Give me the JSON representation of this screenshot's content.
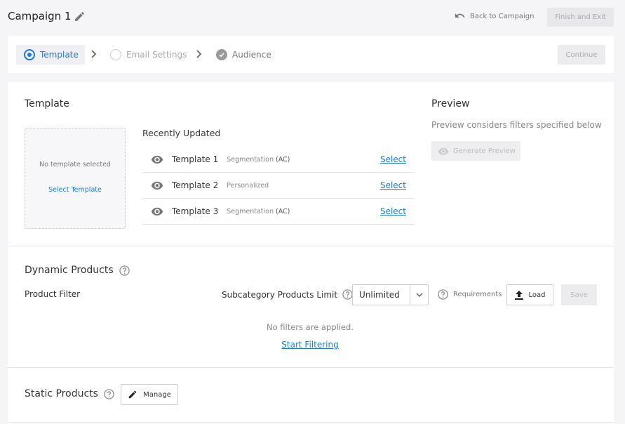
{
  "header": {
    "title": "Campaign 1",
    "back_label": "Back to Campaign",
    "finish_label": "Finish and Exit"
  },
  "steps": [
    {
      "label": "Template",
      "state": "active"
    },
    {
      "label": "Email Settings",
      "state": "pending"
    },
    {
      "label": "Audience",
      "state": "done"
    }
  ],
  "continue_label": "Continue",
  "template_section": {
    "title": "Template",
    "empty_text": "No template selected",
    "select_link": "Select Template",
    "recent_title": "Recently Updated",
    "templates": [
      {
        "name": "Template 1",
        "tag": "Segmentation",
        "tag_extra": "(AC)",
        "action": "Select"
      },
      {
        "name": "Template 2",
        "tag": "Personalized",
        "tag_extra": "",
        "action": "Select"
      },
      {
        "name": "Template 3",
        "tag": "Segmentation",
        "tag_extra": "(AC)",
        "action": "Select"
      }
    ]
  },
  "preview": {
    "title": "Preview",
    "subtitle": "Preview considers filters specified below",
    "generate_label": "Generate Preview"
  },
  "dynamic_products": {
    "title": "Dynamic Products",
    "filter_label": "Product Filter",
    "limit_label": "Subcategory Products Limit",
    "limit_value": "Unlimited",
    "requirements_label": "Requirements",
    "load_label": "Load",
    "save_label": "Save",
    "empty_text": "No filters are applied.",
    "start_link": "Start Filtering"
  },
  "static_products": {
    "title": "Static Products",
    "manage_label": "Manage"
  },
  "colors": {
    "accent": "#1f7ad6",
    "background": "#f5f5f8"
  }
}
